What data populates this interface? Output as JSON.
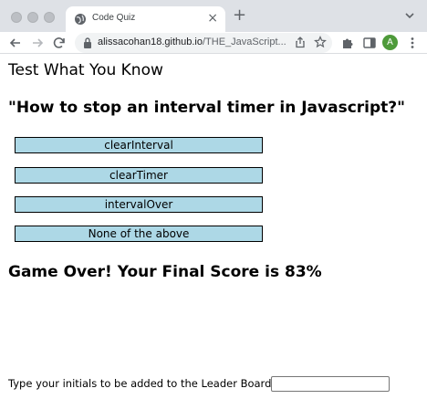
{
  "browser": {
    "tab_title": "Code Quiz",
    "tab_close": "×",
    "new_tab": "+",
    "url_domain": "alissacohan18.github.io",
    "url_path": "/THE_JavaScript...",
    "profile_initial": "A",
    "profile_color": "#4e9a3a"
  },
  "page": {
    "header_title": "Test What You Know",
    "question": "\"How to stop an interval timer in Javascript?\"",
    "answers": [
      "clearInterval",
      "clearTimer",
      "intervalOver",
      "None of the above"
    ],
    "final_score": "Game Over! Your Final Score is 83%",
    "initials_label": "Type your initials to be added to the Leader Board",
    "initials_value": ""
  },
  "colors": {
    "answer_bg": "#add8e6",
    "tabbar_bg": "#dee1e6",
    "omnibox_bg": "#f1f3f4"
  }
}
